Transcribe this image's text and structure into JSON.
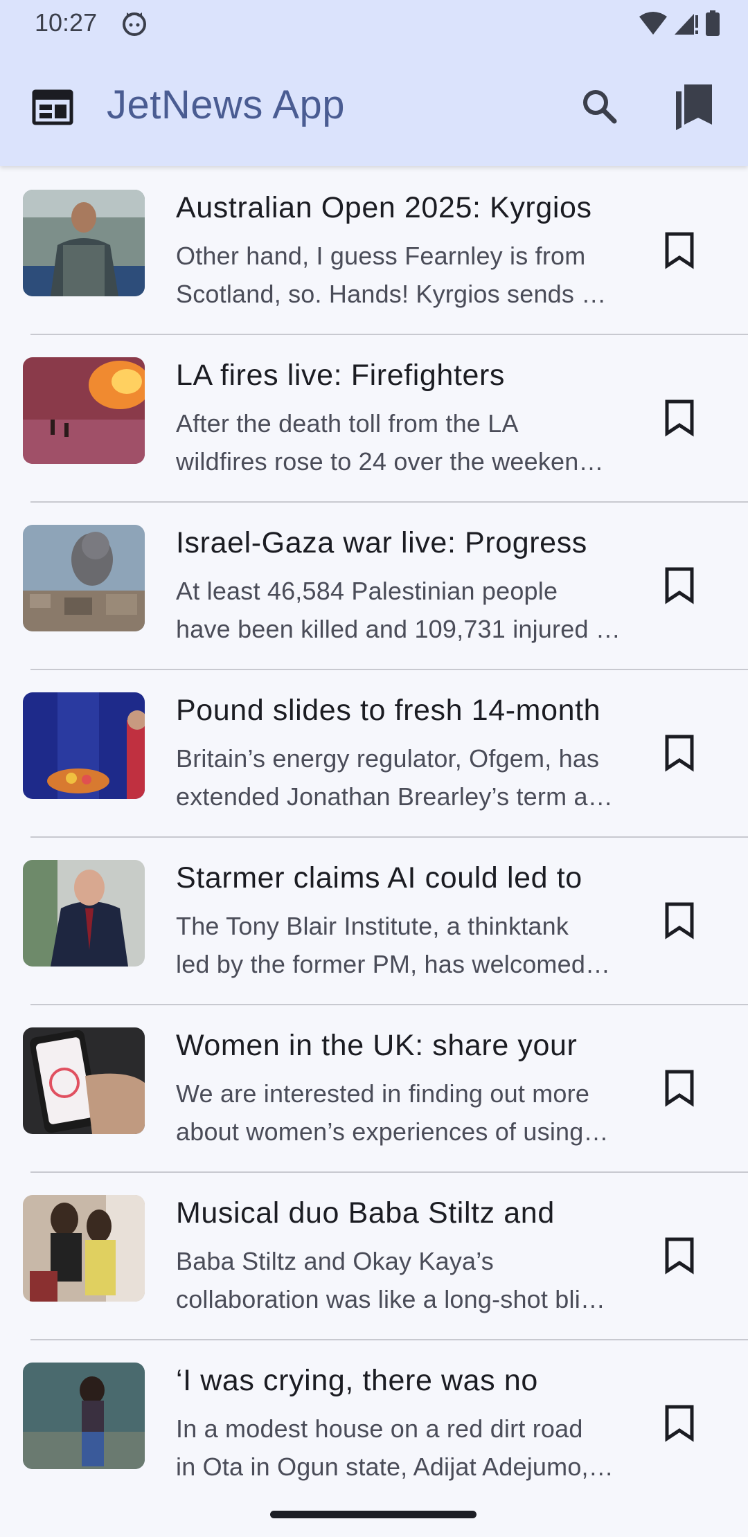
{
  "status_bar": {
    "time": "10:27",
    "icons": [
      "cat-notification-icon",
      "wifi-icon",
      "signal-icon",
      "battery-icon"
    ]
  },
  "app_bar": {
    "title": "JetNews App",
    "nav_icon": "news-icon",
    "actions": [
      "search-icon",
      "bookmarks-icon"
    ]
  },
  "colors": {
    "app_bar_bg": "#dbe3fc",
    "title": "#4a5c92",
    "background": "#f6f7fc"
  },
  "articles": [
    {
      "title": "Australian Open 2025: Kyrgios",
      "summary_line1": "Other hand, I guess Fearnley is from",
      "summary_line2": "Scotland, so. Hands! Kyrgios sends …"
    },
    {
      "title": "LA fires live: Firefighters",
      "summary_line1": "After the death toll from the LA",
      "summary_line2": "wildfires rose to 24 over the weeken…"
    },
    {
      "title": "Israel-Gaza war live: Progress",
      "summary_line1": "At least 46,584 Palestinian people",
      "summary_line2": "have been killed and 109,731 injured …"
    },
    {
      "title": "Pound slides to fresh 14-month",
      "summary_line1": "Britain’s energy regulator, Ofgem, has",
      "summary_line2": "extended Jonathan Brearley’s term a…"
    },
    {
      "title": "Starmer claims AI could led to",
      "summary_line1": "The Tony Blair Institute, a thinktank",
      "summary_line2": "led by the former PM, has welcomed…"
    },
    {
      "title": "Women in the UK: share your",
      "summary_line1": "We are interested in finding out more",
      "summary_line2": "about women’s experiences of using…"
    },
    {
      "title": "Musical duo Baba Stiltz and",
      "summary_line1": "Baba Stiltz and Okay Kaya’s",
      "summary_line2": "collaboration was like a long-shot bli…"
    },
    {
      "title": "‘I was crying, there was no",
      "summary_line1": "In a modest house on a red dirt road",
      "summary_line2": "in Ota in Ogun state, Adijat Adejumo,…"
    }
  ]
}
